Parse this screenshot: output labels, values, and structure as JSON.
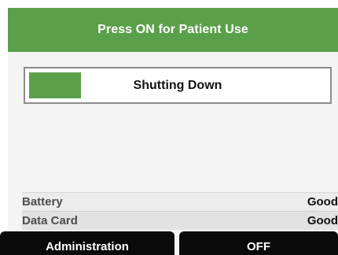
{
  "header": {
    "title": "Press ON for Patient Use"
  },
  "status": {
    "text": "Shutting Down",
    "progress_color": "#5aa04a"
  },
  "info": [
    {
      "label": "Battery",
      "value": "Good"
    },
    {
      "label": "Data Card",
      "value": "Good"
    }
  ],
  "softkeys": {
    "left_label": "Administration",
    "right_label": "OFF"
  },
  "colors": {
    "accent": "#5aa04a",
    "softkey_bg": "#0a0a0a"
  }
}
